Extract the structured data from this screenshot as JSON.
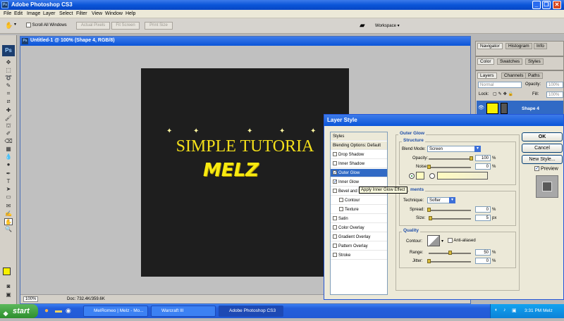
{
  "app": {
    "title": "Adobe Photoshop CS3"
  },
  "menu": [
    "File",
    "Edit",
    "Image",
    "Layer",
    "Select",
    "Filter",
    "View",
    "Window",
    "Help"
  ],
  "options": {
    "scroll_all": "Scroll All Windows",
    "actual_pixels": "Actual Pixels",
    "fit_screen": "Fit Screen",
    "print_size": "Print Size",
    "workspace": "Workspace"
  },
  "document": {
    "title": "Untitled-1 @ 100% (Shape 4, RGB/8)",
    "zoom": "100%",
    "doc_info": "Doc: 732.4K/359.6K",
    "headline": "SIMPLE TUTORIA",
    "logo": "MELZ"
  },
  "panels": {
    "top_tabs": [
      "Navigator",
      "Histogram",
      "Info"
    ],
    "mid_tabs": [
      "Color",
      "Swatches",
      "Styles"
    ],
    "layer_tabs": [
      "Layers",
      "Channels",
      "Paths"
    ],
    "blend_mode": "Normal",
    "opacity_label": "Opacity:",
    "opacity_value": "100%",
    "lock_label": "Lock:",
    "fill_label": "Fill:",
    "fill_value": "100%",
    "layer_name": "Shape 4"
  },
  "dialog": {
    "title": "Layer Style",
    "list": [
      {
        "label": "Styles",
        "type": "header"
      },
      {
        "label": "Blending Options: Default",
        "type": "header"
      },
      {
        "label": "Drop Shadow",
        "checked": false
      },
      {
        "label": "Inner Shadow",
        "checked": false
      },
      {
        "label": "Outer Glow",
        "checked": true,
        "selected": true
      },
      {
        "label": "Inner Glow",
        "checked": true
      },
      {
        "label": "Bevel and E",
        "checked": false
      },
      {
        "label": "Contour",
        "checked": false,
        "indent": true
      },
      {
        "label": "Texture",
        "checked": false,
        "indent": true
      },
      {
        "label": "Satin",
        "checked": false
      },
      {
        "label": "Color Overlay",
        "checked": false
      },
      {
        "label": "Gradient Overlay",
        "checked": false
      },
      {
        "label": "Pattern Overlay",
        "checked": false
      },
      {
        "label": "Stroke",
        "checked": false
      }
    ],
    "section": "Outer Glow",
    "structure": "Structure",
    "blend_mode_label": "Blend Mode:",
    "blend_mode": "Screen",
    "opacity_label": "Opacity:",
    "opacity": "100",
    "noise_label": "Noise:",
    "noise": "0",
    "elements": "ments",
    "technique_label": "Technique:",
    "technique": "Softer",
    "spread_label": "Spread:",
    "spread": "0",
    "size_label": "Size:",
    "size": "5",
    "quality": "Quality",
    "contour_label": "Contour:",
    "anti_aliased": "Anti-aliased",
    "range_label": "Range:",
    "range": "50",
    "jitter_label": "Jitter:",
    "jitter": "0",
    "pct": "%",
    "px": "px",
    "ok": "OK",
    "cancel": "Cancel",
    "new_style": "New Style...",
    "preview": "Preview",
    "tooltip": "Apply Inner Glow Effect"
  },
  "taskbar": {
    "start": "start",
    "tasks": [
      "MelRomeo | Melz - Mo...",
      "Warcraft III",
      "Adobe Photoshop CS3"
    ],
    "clock": "3:31 PM Melz"
  },
  "colors": {
    "headline": "#f4e01a",
    "canvas": "#1e1e1e",
    "accent": "#0a55d8",
    "fg_swatch": "#f8f000"
  }
}
